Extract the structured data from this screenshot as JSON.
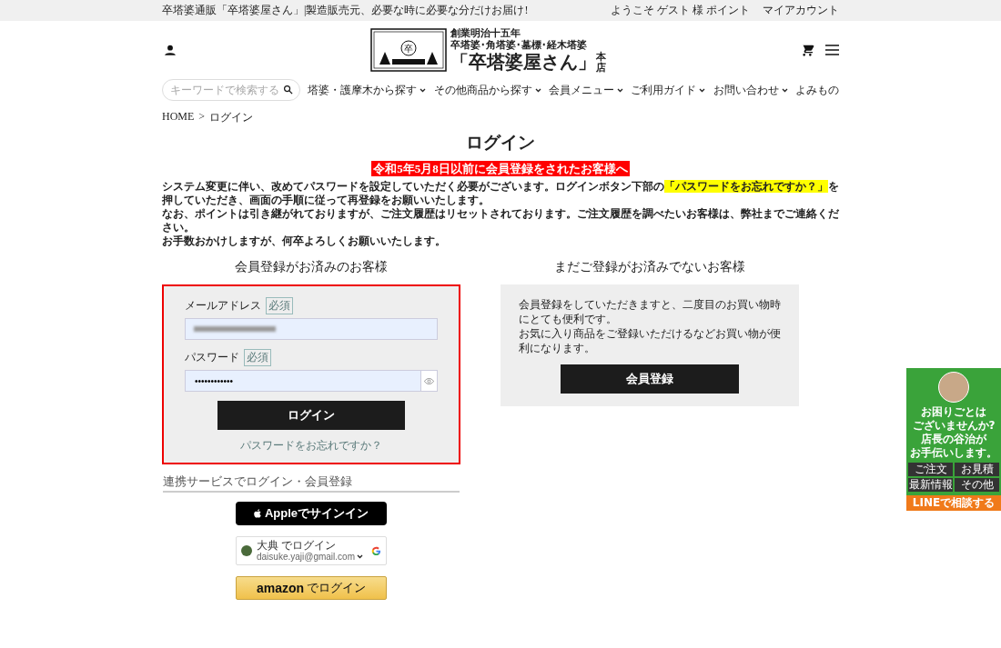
{
  "top_bar": {
    "tagline": "卒塔婆通販「卒塔婆屋さん」|製造販売元、必要な時に必要な分だけお届け!",
    "links": [
      "ようこそ ゲスト 様 ポイント",
      "マイアカウント"
    ]
  },
  "logo": {
    "est": "創業明治十五年",
    "products": "卒塔婆･角塔婆･墓標･経木塔婆",
    "name": "「卒塔婆屋さん」",
    "branch": "本店",
    "stamp_mark": "卒"
  },
  "search": {
    "placeholder": "キーワードで検索する"
  },
  "nav": [
    {
      "label": "塔婆・護摩木から探す",
      "dropdown": true
    },
    {
      "label": "その他商品から探す",
      "dropdown": true
    },
    {
      "label": "会員メニュー",
      "dropdown": true
    },
    {
      "label": "ご利用ガイド",
      "dropdown": true
    },
    {
      "label": "お問い合わせ",
      "dropdown": true
    },
    {
      "label": "よみもの",
      "dropdown": false
    }
  ],
  "breadcrumb": {
    "items": [
      "HOME",
      "ログイン"
    ],
    "separator": ">"
  },
  "title": "ログイン",
  "notice": {
    "heading": "令和5年5月8日以前に会員登録をされたお客様へ",
    "first": {
      "before": "システム変更に伴い、改めてパスワードを設定していただく必要がございます。ログインボタン下部の",
      "highlight": "「パスワードをお忘れですか？」",
      "after": "を押していただき、画面の手順に従って再登録をお願いいたします。"
    },
    "paragraphs": [
      "なお、ポイントは引き継がれておりますが、ご注文履歴はリセットされております。ご注文履歴を調べたいお客様は、弊社までご連絡ください。",
      "お手数おかけしますが、何卒よろしくお願いいたします。"
    ]
  },
  "member": {
    "heading": "会員登録がお済みのお客様",
    "fields": [
      {
        "label": "メールアドレス",
        "badge": "必須",
        "kind": "email"
      },
      {
        "label": "パスワード",
        "badge": "必須",
        "kind": "password",
        "value": "••••••••••••"
      }
    ],
    "button": "ログイン",
    "forgot": "パスワードをお忘れですか？"
  },
  "guest": {
    "heading": "まだご登録がお済みでないお客様",
    "text": [
      "会員登録をしていただきますと、二度目のお買い物時にとても便利です。",
      "お気に入り商品をご登録いただけるなどお買い物が便利になります。"
    ],
    "button": "会員登録"
  },
  "social": {
    "heading": "連携サービスでログイン・会員登録",
    "apple": "Appleでサインイン",
    "google": {
      "line1": "大典 でログイン",
      "line2": "daisuke.yaji@gmail.com"
    },
    "amazon": {
      "brand": "amazon",
      "text": "でログイン"
    }
  },
  "side_banner": {
    "lines": [
      "お困りごとは",
      "ございませんか?",
      "店長の谷治が",
      "お手伝いします。"
    ],
    "tags": [
      "ご注文",
      "お見積",
      "最新情報",
      "その他"
    ],
    "footer": "LINEで相談する"
  }
}
